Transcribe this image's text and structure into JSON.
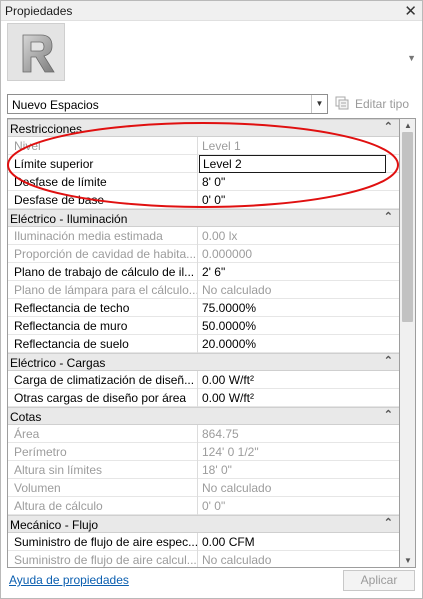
{
  "window": {
    "title": "Propiedades",
    "close_glyph": "✕"
  },
  "type_selector": {
    "value": "Nuevo Espacios",
    "edit_type_label": "Editar tipo"
  },
  "groups": [
    {
      "title": "Restricciones",
      "rows": [
        {
          "name": "Nivel",
          "value": "Level 1",
          "readonly": true
        },
        {
          "name": "Límite superior",
          "value": "Level 2",
          "readonly": false,
          "editing": true
        },
        {
          "name": "Desfase de límite",
          "value": "8'  0\"",
          "readonly": false
        },
        {
          "name": "Desfase de base",
          "value": "0'  0\"",
          "readonly": false
        }
      ]
    },
    {
      "title": "Eléctrico - Iluminación",
      "rows": [
        {
          "name": "Iluminación media estimada",
          "value": "0.00 lx",
          "readonly": true
        },
        {
          "name": "Proporción de cavidad de habita...",
          "value": "0.000000",
          "readonly": true
        },
        {
          "name": "Plano de trabajo de cálculo de il...",
          "value": "2'  6\"",
          "readonly": false
        },
        {
          "name": "Plano de lámpara para el cálculo...",
          "value": "No calculado",
          "readonly": true
        },
        {
          "name": "Reflectancia de techo",
          "value": "75.0000%",
          "readonly": false
        },
        {
          "name": "Reflectancia de muro",
          "value": "50.0000%",
          "readonly": false
        },
        {
          "name": "Reflectancia de suelo",
          "value": "20.0000%",
          "readonly": false
        }
      ]
    },
    {
      "title": "Eléctrico - Cargas",
      "rows": [
        {
          "name": "Carga de climatización de diseñ...",
          "value": "0.00 W/ft²",
          "readonly": false
        },
        {
          "name": "Otras cargas de diseño por área",
          "value": "0.00 W/ft²",
          "readonly": false
        }
      ]
    },
    {
      "title": "Cotas",
      "rows": [
        {
          "name": "Área",
          "value": "864.75",
          "readonly": true
        },
        {
          "name": "Perímetro",
          "value": "124'  0 1/2\"",
          "readonly": true
        },
        {
          "name": "Altura sin límites",
          "value": "18'  0\"",
          "readonly": true
        },
        {
          "name": "Volumen",
          "value": "No calculado",
          "readonly": true
        },
        {
          "name": "Altura de cálculo",
          "value": "0'  0\"",
          "readonly": true
        }
      ]
    },
    {
      "title": "Mecánico - Flujo",
      "rows": [
        {
          "name": "Suministro de flujo de aire espec...",
          "value": "0.00 CFM",
          "readonly": false
        },
        {
          "name": "Suministro de flujo de aire calcul...",
          "value": "No calculado",
          "readonly": true
        }
      ]
    }
  ],
  "footer": {
    "help_link": "Ayuda de propiedades",
    "apply_label": "Aplicar"
  },
  "colors": {
    "annotation_oval": "#e01010",
    "link": "#0b5fb0",
    "readonly_text": "#9c9c9c",
    "group_header_bg": "#e9e9e9"
  },
  "icons": {
    "type_image": "revit-family-icon",
    "collapse": "collapse-chevron-up-icon",
    "edit_type": "edit-type-icon"
  }
}
